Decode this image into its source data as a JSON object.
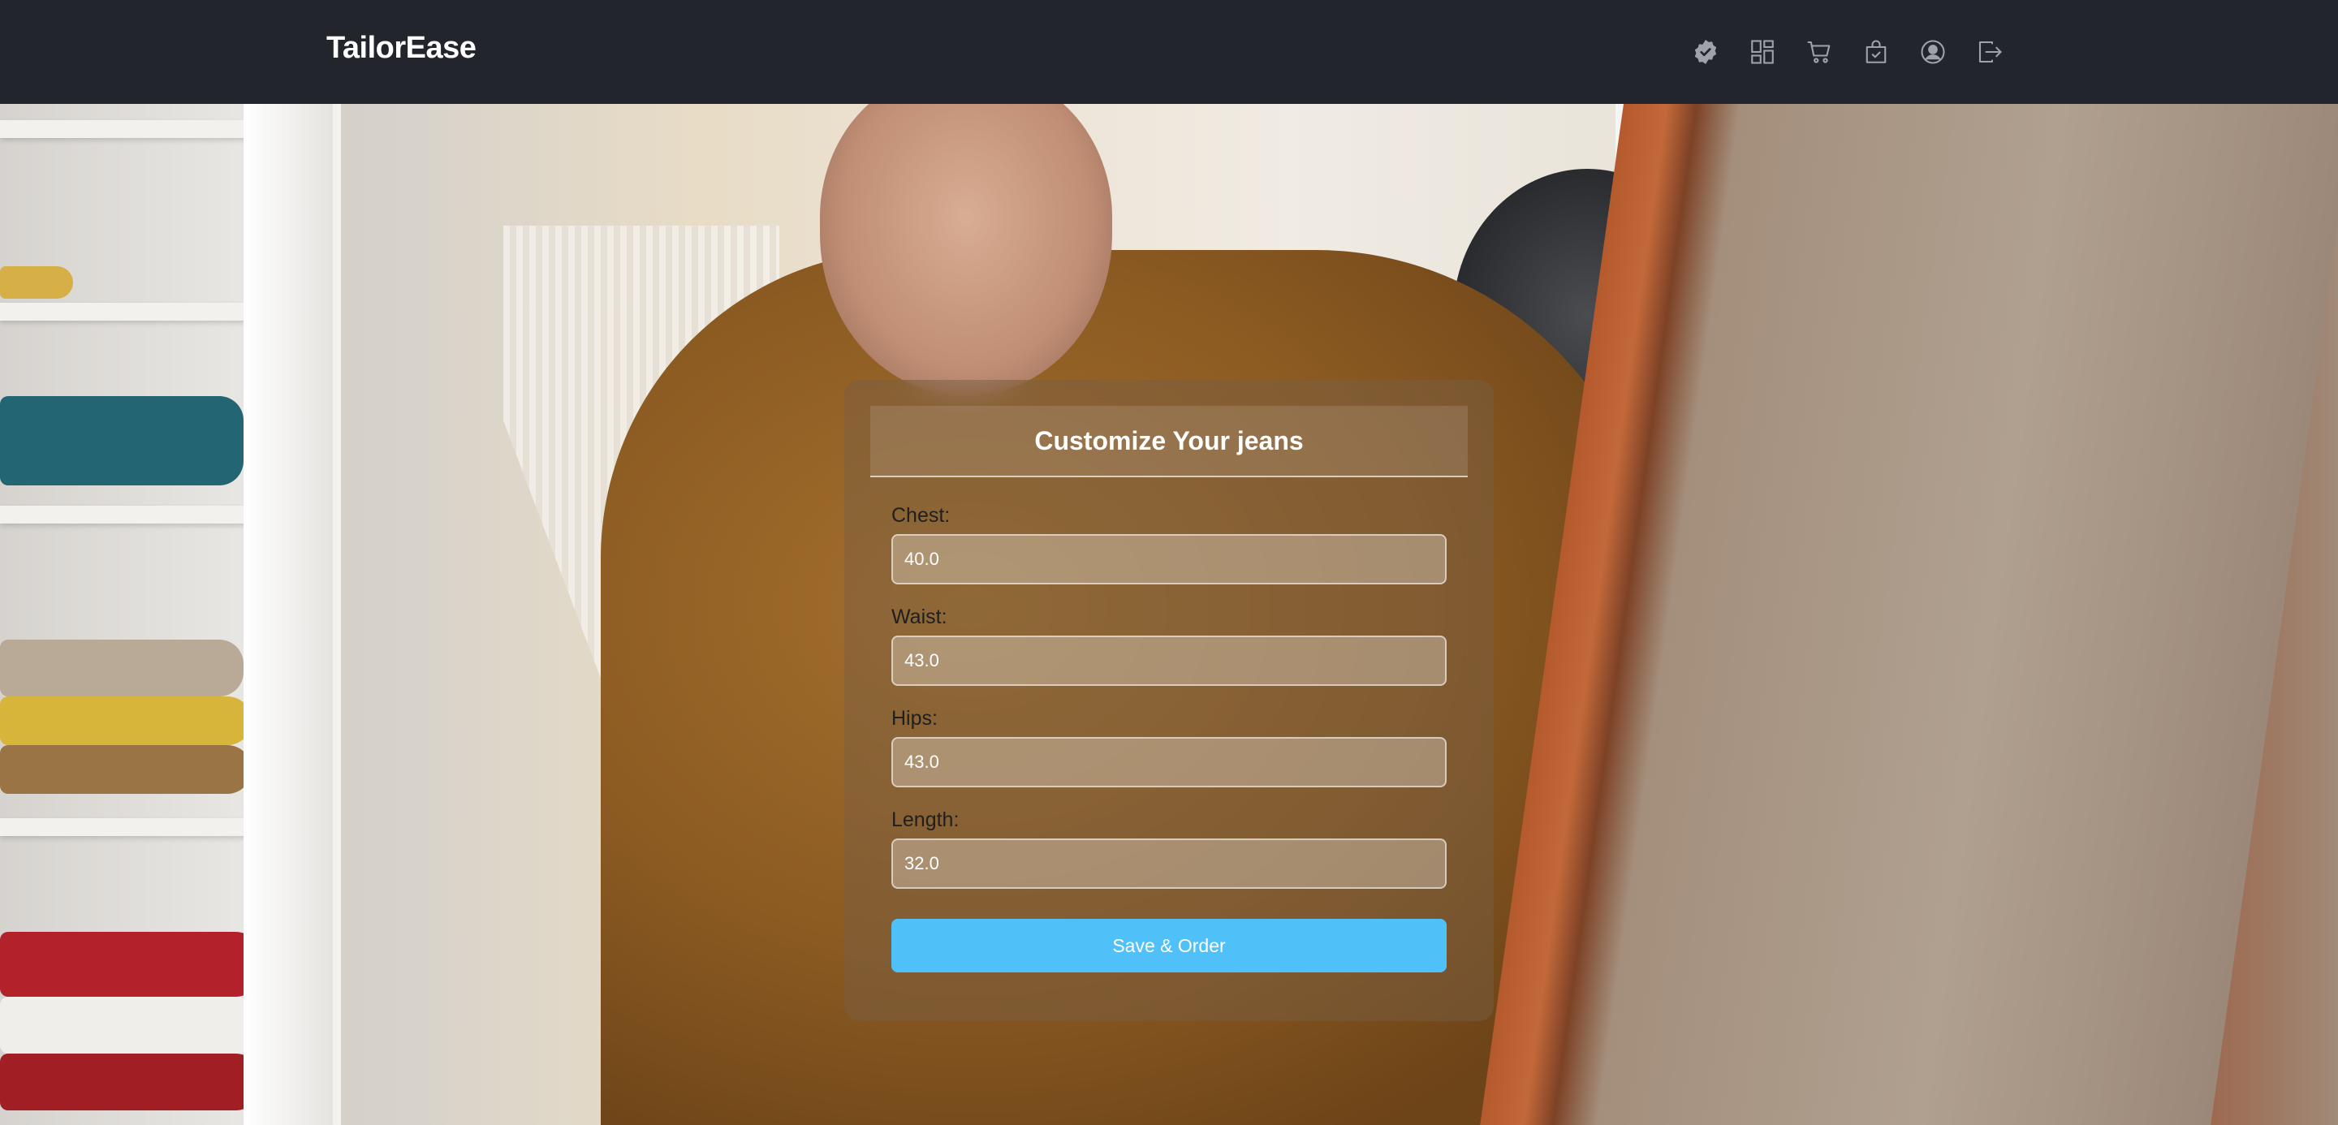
{
  "navbar": {
    "brand": "TailorEase",
    "icons": [
      {
        "name": "verified-badge-icon"
      },
      {
        "name": "dashboard-grid-icon"
      },
      {
        "name": "cart-icon"
      },
      {
        "name": "shopping-bag-check-icon"
      },
      {
        "name": "user-circle-icon"
      },
      {
        "name": "logout-icon"
      }
    ]
  },
  "form": {
    "title": "Customize Your jeans",
    "fields": [
      {
        "label": "Chest:",
        "value": "40.0"
      },
      {
        "label": "Waist:",
        "value": "43.0"
      },
      {
        "label": "Hips:",
        "value": "43.0"
      },
      {
        "label": "Length:",
        "value": "32.0"
      }
    ],
    "submit_label": "Save & Order"
  },
  "colors": {
    "navbar_bg": "#22252b",
    "button_bg": "#4fc0f8",
    "text_light": "#ffffff"
  }
}
